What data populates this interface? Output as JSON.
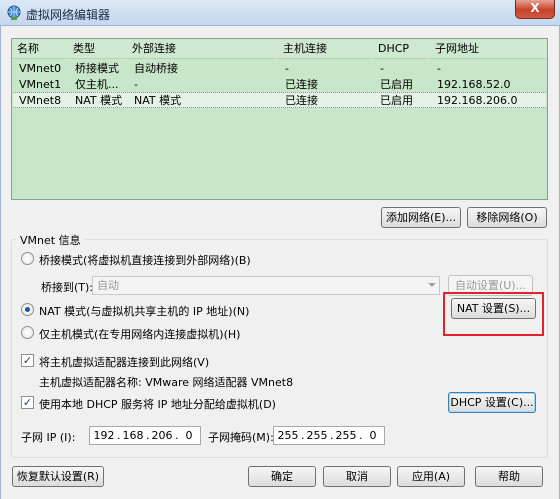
{
  "window": {
    "title": "虚拟网络编辑器",
    "close_label": "X"
  },
  "netlist": {
    "columns": [
      "名称",
      "类型",
      "外部连接",
      "主机连接",
      "DHCP",
      "子网地址"
    ],
    "rows": [
      {
        "name": "VMnet0",
        "type": "桥接模式",
        "external": "自动桥接",
        "host": "-",
        "dhcp": "-",
        "subnet": "-"
      },
      {
        "name": "VMnet1",
        "type": "仅主机...",
        "external": "-",
        "host": "已连接",
        "dhcp": "已启用",
        "subnet": "192.168.52.0"
      },
      {
        "name": "VMnet8",
        "type": "NAT 模式",
        "external": "NAT 模式",
        "host": "已连接",
        "dhcp": "已启用",
        "subnet": "192.168.206.0"
      }
    ],
    "selected_row": 2
  },
  "list_buttons": {
    "add": "添加网络(E)...",
    "remove": "移除网络(O)"
  },
  "vmnet_info": {
    "legend": "VMnet 信息",
    "bridge_radio": "桥接模式(将虚拟机直接连接到外部网络)(B)",
    "bridge_to_label": "桥接到(T):",
    "bridge_to_value": "自动",
    "auto_settings": "自动设置(U)...",
    "nat_radio": "NAT 模式(与虚拟机共享主机的 IP 地址)(N)",
    "nat_settings": "NAT 设置(S)...",
    "hostonly_radio": "仅主机模式(在专用网络内连接虚拟机)(H)",
    "selected_mode": "nat",
    "connect_adapter": "将主机虚拟适配器连接到此网络(V)",
    "connect_adapter_checked": true,
    "adapter_name": "主机虚拟适配器名称: VMware 网络适配器 VMnet8",
    "use_dhcp": "使用本地 DHCP 服务将 IP 地址分配给虚拟机(D)",
    "use_dhcp_checked": true,
    "dhcp_settings": "DHCP 设置(C)...",
    "subnet_ip_label": "子网 IP (I):",
    "subnet_ip": [
      "192",
      "168",
      "206",
      "0"
    ],
    "subnet_mask_label": "子网掩码(M):",
    "subnet_mask": [
      "255",
      "255",
      "255",
      "0"
    ]
  },
  "footer": {
    "restore": "恢复默认设置(R)",
    "ok": "确定",
    "cancel": "取消",
    "apply": "应用(A)",
    "help": "帮助"
  },
  "colors": {
    "list_bg": "#c8e6c9",
    "highlight": "#e3202b",
    "title_bar": "#c4d7ee"
  }
}
